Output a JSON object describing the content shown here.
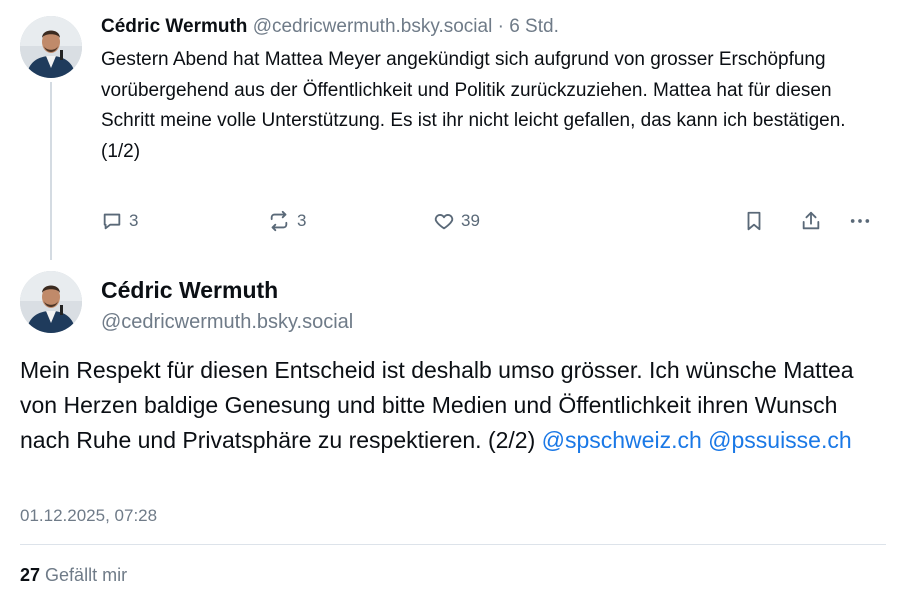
{
  "post1": {
    "author_name": "Cédric Wermuth",
    "handle": "@cedricwermuth.bsky.social",
    "separator": "·",
    "time": "6 Std.",
    "text": "Gestern Abend hat Mattea Meyer angekündigt sich aufgrund von grosser Erschöpfung vorübergehend aus der Öffentlichkeit und Politik zurückzuziehen. Mattea hat für diesen Schritt meine volle Unterstützung. Es ist ihr nicht leicht gefallen, das kann ich bestätigen. (1/2)",
    "actions": {
      "replies": "3",
      "reposts": "3",
      "likes": "39"
    }
  },
  "post2": {
    "author_name": "Cédric Wermuth",
    "handle": "@cedricwermuth.bsky.social",
    "text": "Mein Respekt für diesen Entscheid ist deshalb umso grösser. Ich wünsche Mattea von Herzen baldige Genesung und bitte Medien und Öffentlichkeit ihren Wunsch nach Ruhe und Privatsphäre zu respektieren. (2/2) ",
    "mentions": [
      "@spschweiz.ch",
      "@pssuisse.ch"
    ],
    "timestamp": "01.12.2025, 07:28",
    "like_count": "27",
    "like_label": "Gefällt mir"
  },
  "colors": {
    "accent": "#1a78e6",
    "muted": "#6f7b88",
    "icon": "#5a6978"
  },
  "icons": [
    "reply-icon",
    "repost-icon",
    "heart-icon",
    "bookmark-icon",
    "share-icon",
    "more-icon"
  ]
}
